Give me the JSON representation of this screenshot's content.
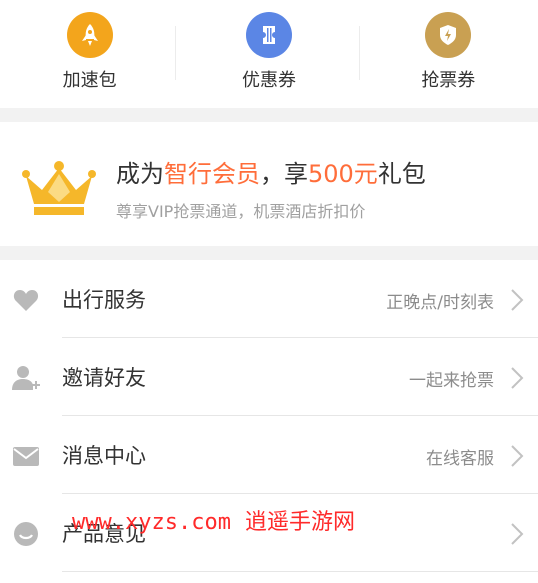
{
  "shortcuts": [
    {
      "label": "加速包",
      "icon": "rocket-icon",
      "color": "#f3a51c"
    },
    {
      "label": "优惠券",
      "icon": "coupon-icon",
      "color": "#5b86e5"
    },
    {
      "label": "抢票券",
      "icon": "shield-bolt-icon",
      "color": "#c9a052"
    }
  ],
  "vip": {
    "title_pre": "成为",
    "title_brand": "智行会员",
    "title_mid": "，享",
    "title_amount": "500元",
    "title_post": "礼包",
    "subtitle": "尊享VIP抢票通道，机票酒店折扣价",
    "accent_color": "#ff6d3a"
  },
  "menu": [
    {
      "title": "出行服务",
      "detail": "正晚点/时刻表",
      "icon": "heart-icon"
    },
    {
      "title": "邀请好友",
      "detail": "一起来抢票",
      "icon": "add-user-icon"
    },
    {
      "title": "消息中心",
      "detail": "在线客服",
      "icon": "mail-icon"
    },
    {
      "title": "产品意见",
      "detail": "",
      "icon": "feedback-icon"
    }
  ],
  "watermark": {
    "url": "www.xyzs.com",
    "text": "逍遥手游网"
  }
}
